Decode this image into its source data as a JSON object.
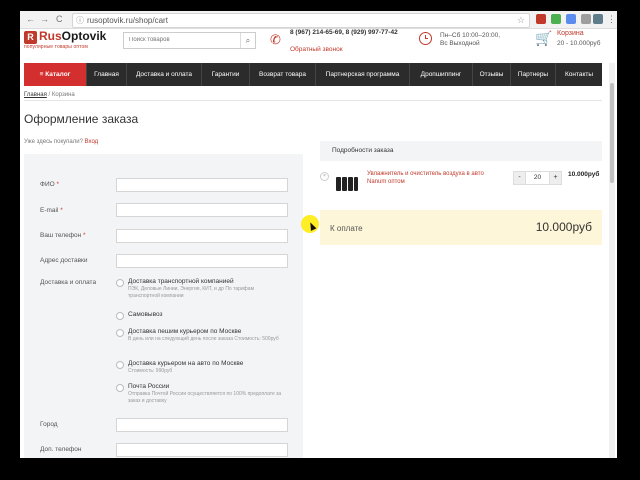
{
  "browser": {
    "url": "rusoptovik.ru/shop/cart",
    "back_glyph": "←",
    "forward_glyph": "→",
    "reload_glyph": "C",
    "menu_glyph": "⋮"
  },
  "header": {
    "logo_mark": "R",
    "logo_part1": "Rus",
    "logo_part2": "Optovik",
    "logo_sub": "популярные товары оптом",
    "search_placeholder": "Поиск товаров",
    "phones": "8 (967) 214-65-69, 8 (929) 997-77-42",
    "callback": "Обратный звонок",
    "hours_line1": "Пн–Сб 10:00–20:00,",
    "hours_line2": "Вс Выходной",
    "cart_title": "Корзина",
    "cart_summary": "20 - 10.000руб"
  },
  "nav": {
    "catalog": "≡ Каталог",
    "items": [
      "Главная",
      "Доставка и оплата",
      "Гарантии",
      "Возврат товара",
      "Партнерская программа",
      "Дропшиппинг",
      "Отзывы",
      "Партнеры",
      "Контакты"
    ]
  },
  "breadcrumb": {
    "home": "Главная",
    "sep": " / ",
    "current": "Корзина"
  },
  "page": {
    "title": "Оформление заказа",
    "already_text": "Уже здесь покупали?",
    "login_link": "Вход"
  },
  "form": {
    "fio": {
      "label": "ФИО",
      "required": "*"
    },
    "email": {
      "label": "E-mail",
      "required": "*"
    },
    "phone": {
      "label": "Ваш телефон",
      "required": "*"
    },
    "address": {
      "label": "Адрес доставки"
    },
    "delivery_label": "Доставка и оплата",
    "delivery_options": [
      {
        "title": "Доставка транспортной компанией",
        "desc": "ПЭК, Деловые Линии, Энергия, КИТ, и др По тарифам транспортной компании"
      },
      {
        "title": "Самовывоз",
        "desc": ""
      },
      {
        "title": "Доставка пешим курьером по Москве",
        "desc": "В день или на следующий день после заказа Стоимость: 500руб"
      },
      {
        "title": "Доставка курьером на авто по Москве",
        "desc": "Стоимость: 990руб"
      },
      {
        "title": "Почта России",
        "desc": "Отправка Почтой России осуществляется по 100% предоплате за заказ и доставку"
      }
    ],
    "city": {
      "label": "Город"
    },
    "extra_phone": {
      "label": "Доп. телефон"
    }
  },
  "order": {
    "title": "Подробности заказа",
    "remove_glyph": "×",
    "item": {
      "name": "Увлажнитель и очиститель воздуха в авто Nanum оптом",
      "qty": "20",
      "minus": "-",
      "plus": "+",
      "price": "10.000руб"
    },
    "total_label": "К оплате",
    "total_value": "10.000руб"
  },
  "colors": {
    "accent": "#c0392b",
    "nav_bg": "#2b2b2b",
    "catalog_bg": "#d32f2f",
    "total_bg": "#fdf6d9"
  }
}
